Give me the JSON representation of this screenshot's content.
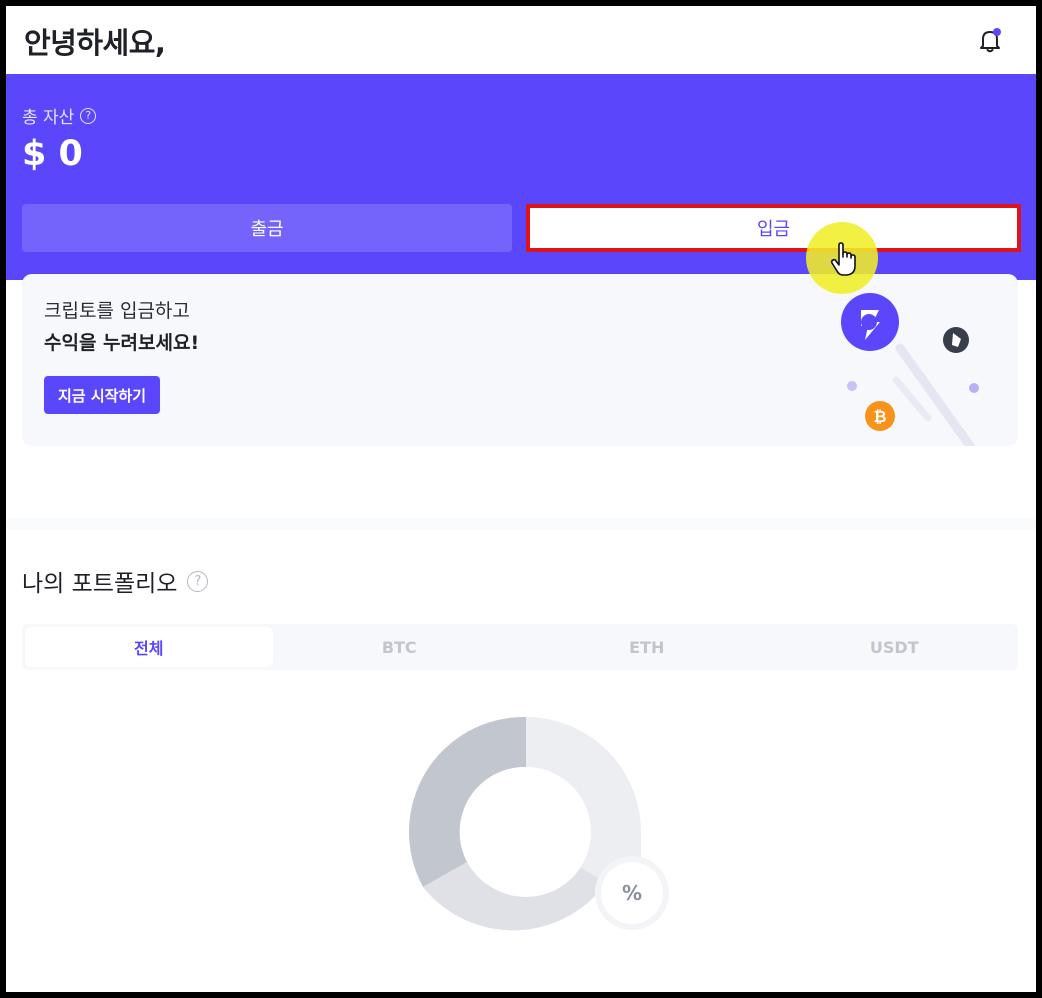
{
  "header": {
    "greeting": "안녕하세요,"
  },
  "assets": {
    "label": "총 자산",
    "help_glyph": "?",
    "value": "$ 0"
  },
  "actions": {
    "withdraw_label": "출금",
    "deposit_label": "입금"
  },
  "promo": {
    "line1": "크립토를 입금하고",
    "line2": "수익을 누려보세요!",
    "button_label": "지금 시작하기"
  },
  "portfolio": {
    "title": "나의 포트폴리오",
    "help_glyph": "?",
    "tabs": [
      {
        "label": "전체",
        "active": true
      },
      {
        "label": "BTC",
        "active": false
      },
      {
        "label": "ETH",
        "active": false
      },
      {
        "label": "USDT",
        "active": false
      }
    ],
    "center_badge": "%"
  },
  "colors": {
    "brand": "#5b47fb",
    "withdraw_button": "#7464fc",
    "highlight_border": "#e0121a",
    "cursor_halo": "#f0ee28",
    "bitcoin": "#f7931a"
  },
  "icons": {
    "notification": "bell-icon",
    "cursor": "hand-pointer-icon",
    "help": "question-circle-icon"
  }
}
